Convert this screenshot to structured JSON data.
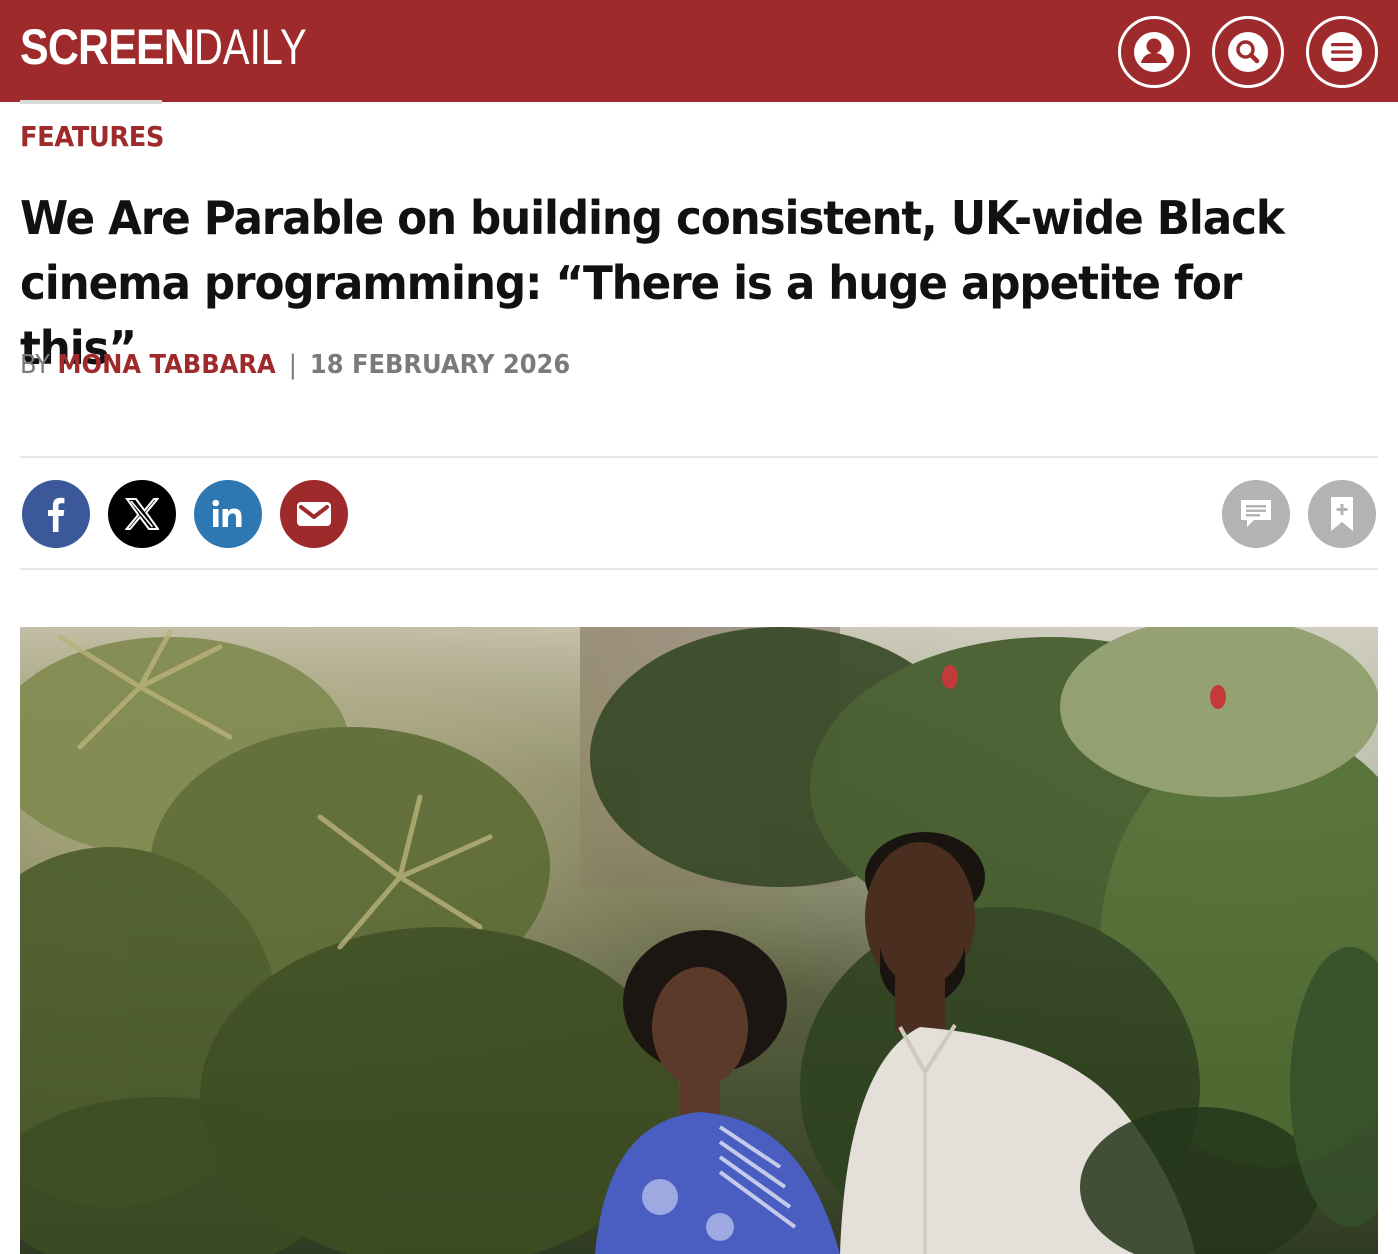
{
  "header": {
    "logo_bold": "SCREEN",
    "logo_light": "DAILY",
    "colors": {
      "brand": "#9e2a2b",
      "text": "#ffffff"
    },
    "icons": [
      "account-icon",
      "search-icon",
      "menu-icon"
    ]
  },
  "article": {
    "section": "FEATURES",
    "headline_line1": "We Are Parable on building consistent, UK-wide Black",
    "headline_line2": "cinema programming: “There is a huge appetite for this”",
    "byline_prefix": "BY",
    "author": "MONA TABBARA",
    "separator": "|",
    "date": "18 FEBRUARY 2026"
  },
  "share": {
    "items": [
      {
        "name": "facebook",
        "glyph": "f",
        "color": "#3b5998"
      },
      {
        "name": "x",
        "glyph": "X",
        "color": "#000000"
      },
      {
        "name": "linkedin",
        "glyph": "in",
        "color": "#2d77b3"
      },
      {
        "name": "email",
        "glyph": "mail",
        "color": "#9e2a2b"
      }
    ],
    "actions": [
      {
        "name": "comments",
        "icon": "comment-icon"
      },
      {
        "name": "bookmark",
        "icon": "bookmark-add-icon"
      }
    ]
  },
  "hero": {
    "image": "photo-two-people-in-garden"
  }
}
